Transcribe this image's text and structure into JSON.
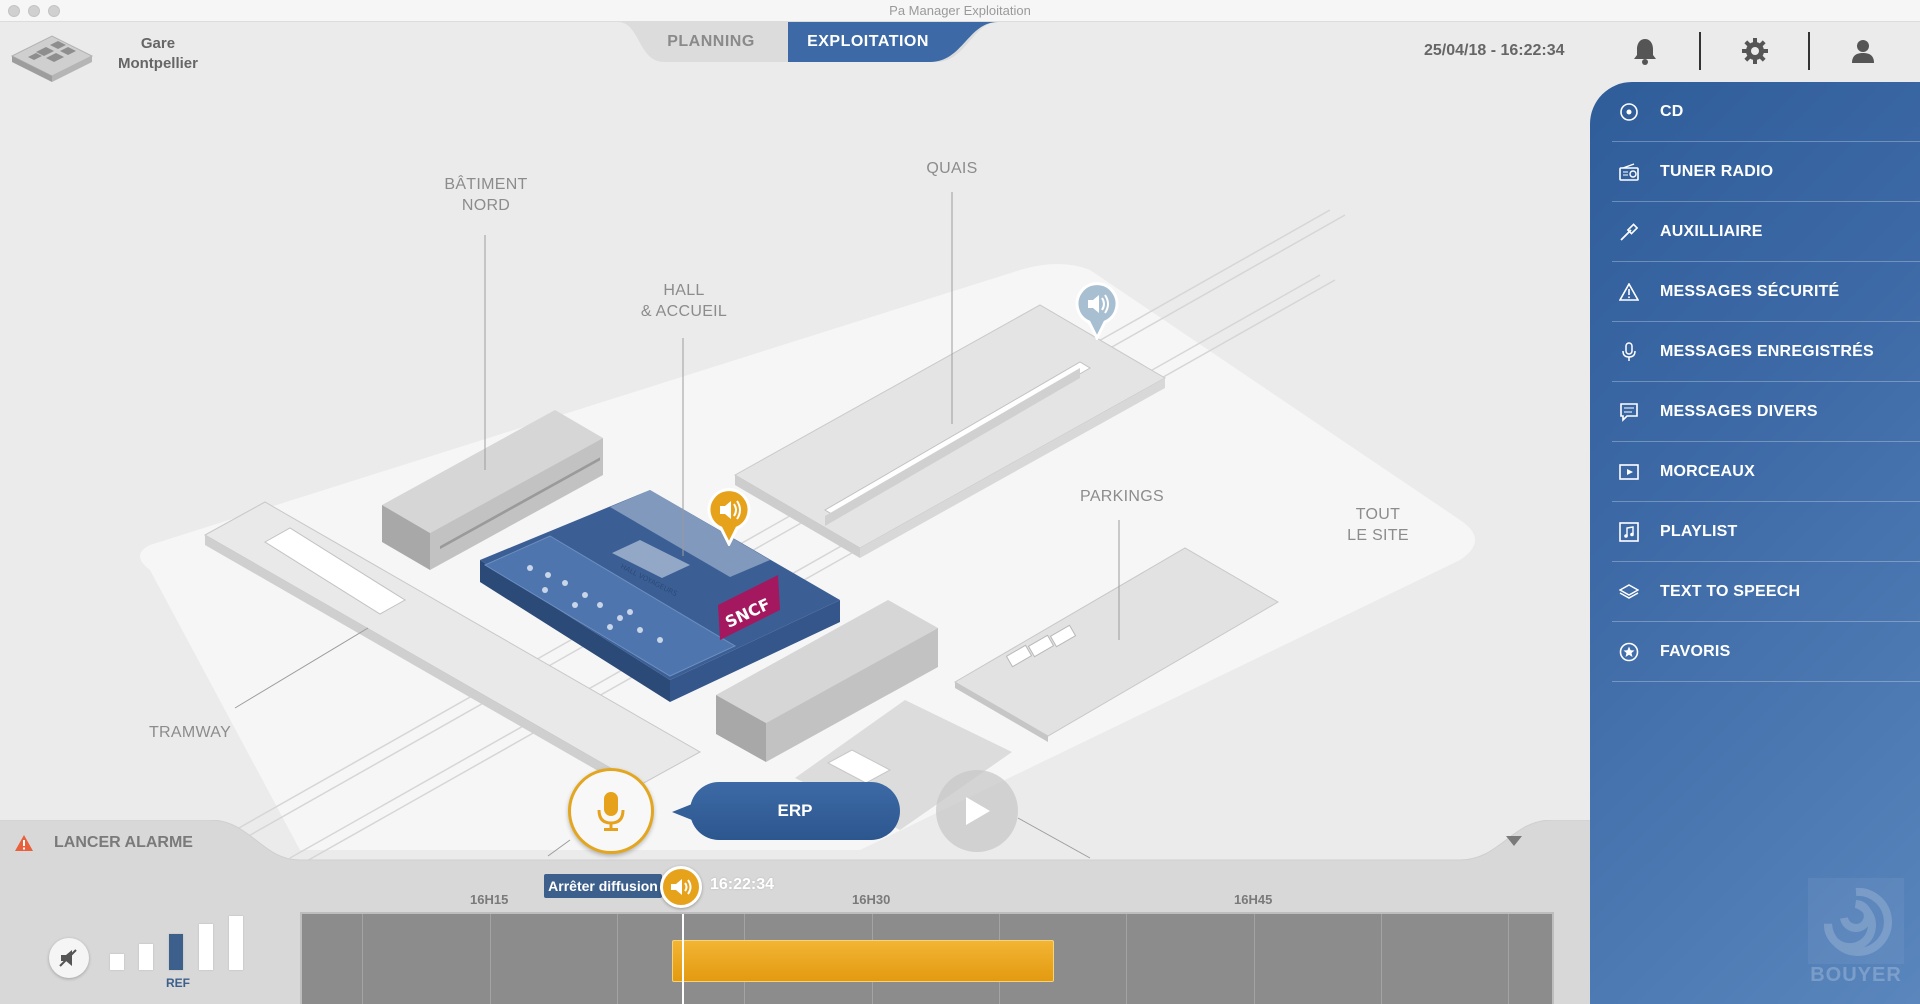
{
  "window": {
    "title": "Pa Manager Exploitation"
  },
  "header": {
    "station_line1": "Gare",
    "station_line2": "Montpellier",
    "tabs": [
      {
        "label": "PLANNING",
        "active": false
      },
      {
        "label": "EXPLOITATION",
        "active": true
      }
    ],
    "datetime": "25/04/18 - 16:22:34",
    "icons": [
      "bell-icon",
      "gear-icon",
      "user-icon"
    ]
  },
  "map": {
    "labels": {
      "batiment_nord_1": "BÂTIMENT",
      "batiment_nord_2": "NORD",
      "hall_1": "HALL",
      "hall_2": "& ACCUEIL",
      "quais": "QUAIS",
      "parkings": "PARKINGS",
      "tout_1": "TOUT",
      "tout_2": "LE SITE",
      "tramway": "TRAMWAY"
    },
    "hall_sign": "HALL VOYAGEURS",
    "sncf_logo": "SNCF"
  },
  "sources": [
    {
      "label": "CD",
      "icon": "cd-icon"
    },
    {
      "label": "TUNER RADIO",
      "icon": "radio-icon"
    },
    {
      "label": "AUXILLIAIRE",
      "icon": "aux-cable-icon"
    },
    {
      "label": "MESSAGES SÉCURITÉ",
      "icon": "warning-icon"
    },
    {
      "label": "MESSAGES ENREGISTRÉS",
      "icon": "microphone-icon"
    },
    {
      "label": "MESSAGES DIVERS",
      "icon": "chat-icon"
    },
    {
      "label": "MORCEAUX",
      "icon": "video-clip-icon"
    },
    {
      "label": "PLAYLIST",
      "icon": "playlist-icon"
    },
    {
      "label": "TEXT TO SPEECH",
      "icon": "speech-layers-icon"
    },
    {
      "label": "FAVORIS",
      "icon": "star-icon"
    }
  ],
  "brand": "BOUYER",
  "bottom": {
    "alarm_label": "LANCER ALARME",
    "erp_label": "ERP",
    "stop_label": "Arrêter diffusion",
    "live_time": "16:22:34",
    "ticks": [
      "16H15",
      "16H30",
      "16H45"
    ],
    "volume_ref_label": "REF",
    "volume_level_steps": 5,
    "volume_selected_step": 3
  },
  "colors": {
    "accent_blue": "#3d6aa6",
    "accent_orange": "#e6a21b",
    "sncf": "#a3185f"
  }
}
